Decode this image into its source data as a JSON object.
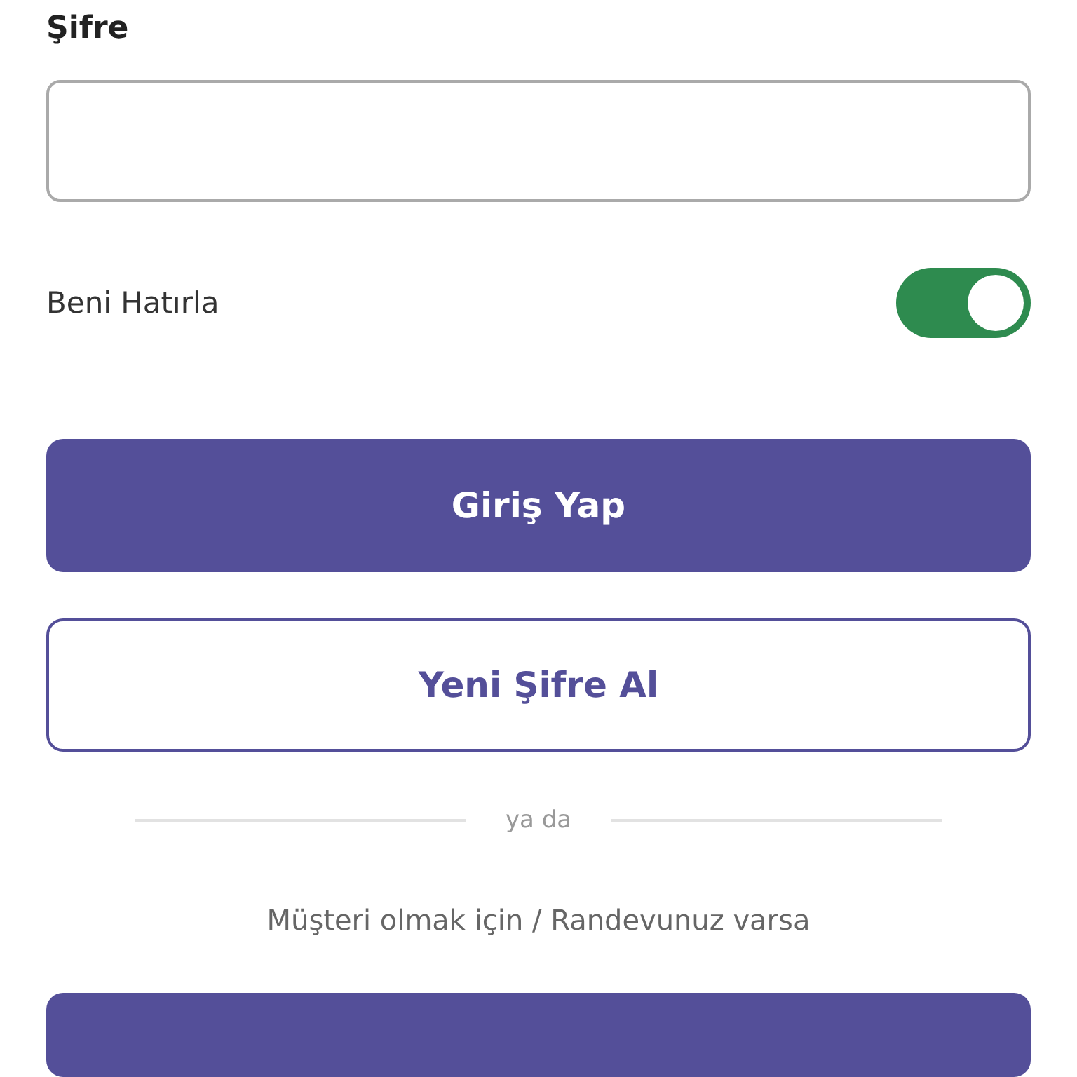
{
  "password": {
    "label": "Şifre"
  },
  "remember": {
    "label": "Beni Hatırla",
    "on": true
  },
  "buttons": [
    {
      "label": "Giriş Yap",
      "kind": "primary"
    },
    {
      "label": "Yeni Şifre Al",
      "kind": "outline"
    }
  ],
  "divider": {
    "label": "ya da"
  },
  "note": "Müşteri olmak için / Randevunuz varsa",
  "bottom_button": {
    "kind": "primary"
  }
}
